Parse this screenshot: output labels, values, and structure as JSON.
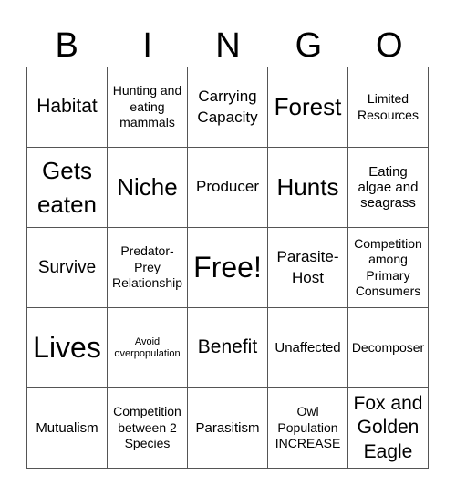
{
  "header": {
    "letters": [
      "B",
      "I",
      "N",
      "G",
      "O"
    ]
  },
  "cells": [
    {
      "text": "Habitat",
      "size": "s21"
    },
    {
      "text": "Hunting and eating mammals",
      "size": "s14"
    },
    {
      "text": "Carrying Capacity",
      "size": "s17"
    },
    {
      "text": "Forest",
      "size": "s26"
    },
    {
      "text": "Limited Resources",
      "size": "s14"
    },
    {
      "text": "Gets eaten",
      "size": "s26"
    },
    {
      "text": "Niche",
      "size": "s26"
    },
    {
      "text": "Producer",
      "size": "s17"
    },
    {
      "text": "Hunts",
      "size": "s26"
    },
    {
      "text": "Eating algae and seagrass",
      "size": "s15"
    },
    {
      "text": "Survive",
      "size": "s19"
    },
    {
      "text": "Predator-Prey Relationship",
      "size": "s14"
    },
    {
      "text": "Free!",
      "size": "s32"
    },
    {
      "text": "Parasite-Host",
      "size": "s17"
    },
    {
      "text": "Competition among Primary Consumers",
      "size": "s14"
    },
    {
      "text": "Lives",
      "size": "s32"
    },
    {
      "text": "Avoid overpopulation",
      "size": "s11"
    },
    {
      "text": "Benefit",
      "size": "s21"
    },
    {
      "text": "Unaffected",
      "size": "s15"
    },
    {
      "text": "Decomposer",
      "size": "s14"
    },
    {
      "text": "Mutualism",
      "size": "s15"
    },
    {
      "text": "Competition between 2 Species",
      "size": "s14"
    },
    {
      "text": "Parasitism",
      "size": "s15"
    },
    {
      "text": "Owl Population INCREASE",
      "size": "s14"
    },
    {
      "text": "Fox and Golden Eagle",
      "size": "s21"
    }
  ]
}
